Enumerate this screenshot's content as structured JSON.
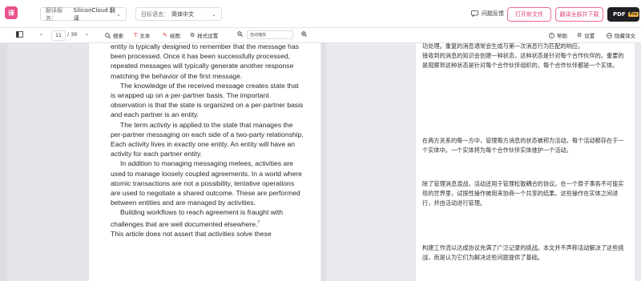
{
  "topbar": {
    "logo_text": "译",
    "translation_service": {
      "label": "翻译服务：",
      "value": "SiliconCloud 翻译"
    },
    "target_language": {
      "label": "目标语言：",
      "value": "简体中文"
    },
    "feedback": "问题反馈",
    "open_new_file": "打开新文件",
    "download_translation": "翻译全部并下载",
    "pdf_button": "PDF",
    "pro_badge": "Pro"
  },
  "toolbar": {
    "current_page": "11",
    "total_pages": "/ 30",
    "search": "搜索",
    "text": "文本",
    "draw": "绘图",
    "style_settings": "样式设置",
    "zoom": "自动缩放",
    "help": "帮助",
    "settings": "设置",
    "hide_translation": "隐藏译文"
  },
  "english": {
    "paragraphs": [
      {
        "text": "entity is typically designed to remember that the message has been processed. Once it has been successfully processed, repeated messages will typically generate another response matching the behavior of the first message.",
        "indent": false
      },
      {
        "text": "The knowledge of the received message creates state that is wrapped up on a per-partner basis. The important observation is that the state is organized on a per-partner basis and each partner is an entity.",
        "indent": true
      },
      {
        "text_pre": "The term ",
        "text_italic": "activity",
        "text_post": " is applied to the state that manages the per-partner messaging on each side of a two-party relationship. Each activity lives in exactly one entity. An entity will have an activity for each partner entity.",
        "indent": true
      },
      {
        "text": "In addition to managing messaging melees, activities are used to manage loosely coupled agreements. In a world where atomic transactions are not a possibility, tentative operations are used to negotiate a shared outcome. These are performed between entities and are managed by activities.",
        "indent": true
      },
      {
        "text": "Building workflows to reach agreement is fraught with challenges that are well documented elsewhere.",
        "sup": "7",
        "indent": true
      },
      {
        "text": "This article does not assert that activities solve these",
        "indent": false
      }
    ]
  },
  "chinese": {
    "blocks": [
      "功处理。重复的消息通常会生成与第一次消息行为匹配的响应。\n接收到的消息的知识会创建一种状态，这种状态是针对每个合作伙伴的。重要的是观察到这种状态是针对每个合作伙伴组织的，每个合作伙伴都是一个实体。",
      "在两方关系的每一方中，管理每方消息的状态被称为活动。每个活动都存在于一个实体中。一个实体将为每个合作伙伴实体维护一个活动。",
      "除了管理消息混战，活动还用于管理松散耦合的协议。在一个原子事务不可能实现的世界里，试探性操作被用来协商一个共享的结果。这些操作在实体之间进行，并由活动进行管理。",
      "构建工作流以达成协议充满了广泛记录的挑战。本文并不声称活动解决了这些挑战，而是认为它们为解决这些问题提供了基础。"
    ]
  }
}
